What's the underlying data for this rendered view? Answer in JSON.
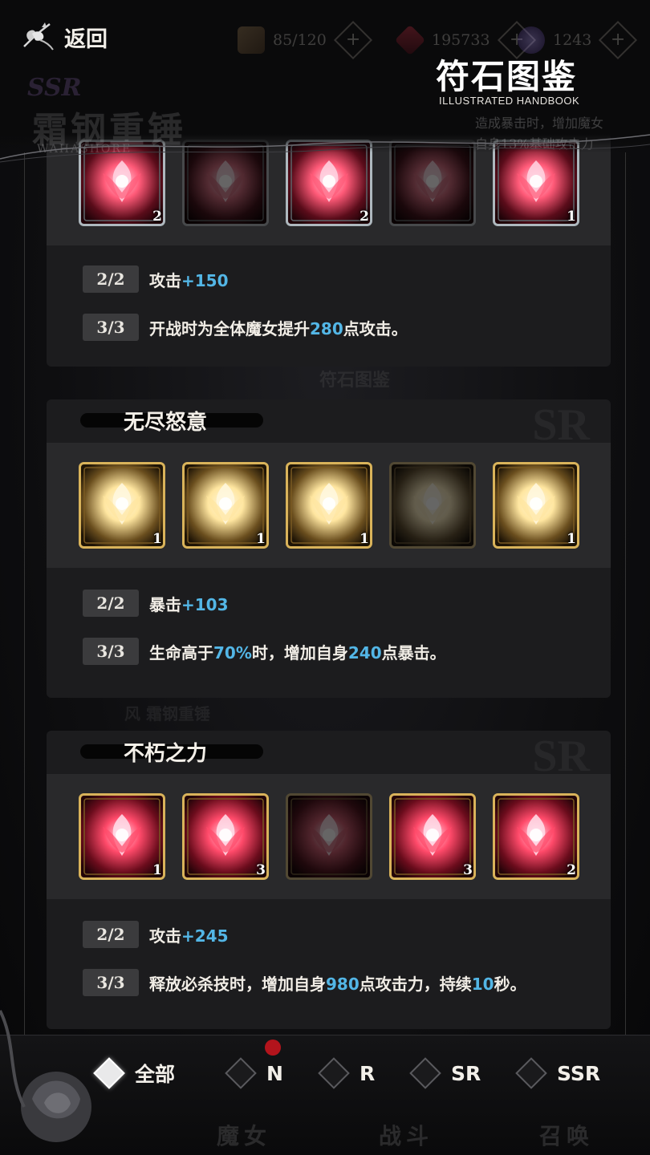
{
  "header": {
    "back_label": "返回",
    "title": "符石图鉴",
    "subtitle": "ILLUSTRATED HANDBOOK",
    "resources": [
      {
        "icon": "cards-icon",
        "value": "85/120"
      },
      {
        "icon": "red-crystal-icon",
        "value": "195733"
      },
      {
        "icon": "purple-orb-icon",
        "value": "1243"
      }
    ]
  },
  "background": {
    "rarity": "SSR",
    "name": "霜钢重锤",
    "name_en": "WAHASHORE",
    "desc_line1": "造成暴击时，增加魔女",
    "desc_line2": "自身13%基础攻击力",
    "ghost_center": "符石图鉴",
    "ghost_lower": "风 霜钢重锤"
  },
  "cards": [
    {
      "title": "",
      "rarity": "",
      "rune_color": "red-silver",
      "runes": [
        {
          "count": "2",
          "owned": true
        },
        {
          "count": "",
          "owned": false
        },
        {
          "count": "2",
          "owned": true
        },
        {
          "count": "",
          "owned": false
        },
        {
          "count": "1",
          "owned": true
        }
      ],
      "bonuses": [
        {
          "tag": "2/2",
          "text": "攻击",
          "value": "+150",
          "text2": ""
        },
        {
          "tag": "3/3",
          "text": "开战时为全体魔女提升",
          "value": "280",
          "text2": "点攻击。"
        }
      ]
    },
    {
      "title": "无尽怒意",
      "rarity": "SR",
      "rune_color": "gold",
      "runes": [
        {
          "count": "1",
          "owned": true
        },
        {
          "count": "1",
          "owned": true
        },
        {
          "count": "1",
          "owned": true
        },
        {
          "count": "",
          "owned": false
        },
        {
          "count": "1",
          "owned": true
        }
      ],
      "bonuses": [
        {
          "tag": "2/2",
          "text": "暴击",
          "value": "+103",
          "text2": ""
        },
        {
          "tag": "3/3",
          "text": "生命高于",
          "value": "70%",
          "text2": "时，增加自身",
          "value2": "240",
          "text3": "点暴击。"
        }
      ]
    },
    {
      "title": "不朽之力",
      "rarity": "SR",
      "rune_color": "red-gold",
      "runes": [
        {
          "count": "1",
          "owned": true
        },
        {
          "count": "3",
          "owned": true
        },
        {
          "count": "",
          "owned": false
        },
        {
          "count": "3",
          "owned": true
        },
        {
          "count": "2",
          "owned": true
        }
      ],
      "bonuses": [
        {
          "tag": "2/2",
          "text": "攻击",
          "value": "+245",
          "text2": ""
        },
        {
          "tag": "3/3",
          "text": "释放必杀技时，增加自身",
          "value": "980",
          "text2": "点攻击力，持续",
          "value2": "10",
          "text3": "秒。"
        }
      ]
    }
  ],
  "filters": [
    {
      "label": "全部",
      "active": true
    },
    {
      "label": "N",
      "active": false
    },
    {
      "label": "R",
      "active": false
    },
    {
      "label": "SR",
      "active": false
    },
    {
      "label": "SSR",
      "active": false
    }
  ],
  "nav_ghost": [
    "魔女",
    "战斗",
    "召唤"
  ],
  "colors": {
    "highlight": "#53b6e6",
    "gold": "#d9b35a",
    "silver": "#b9c2c8",
    "red_glow": "#e83a5c"
  }
}
